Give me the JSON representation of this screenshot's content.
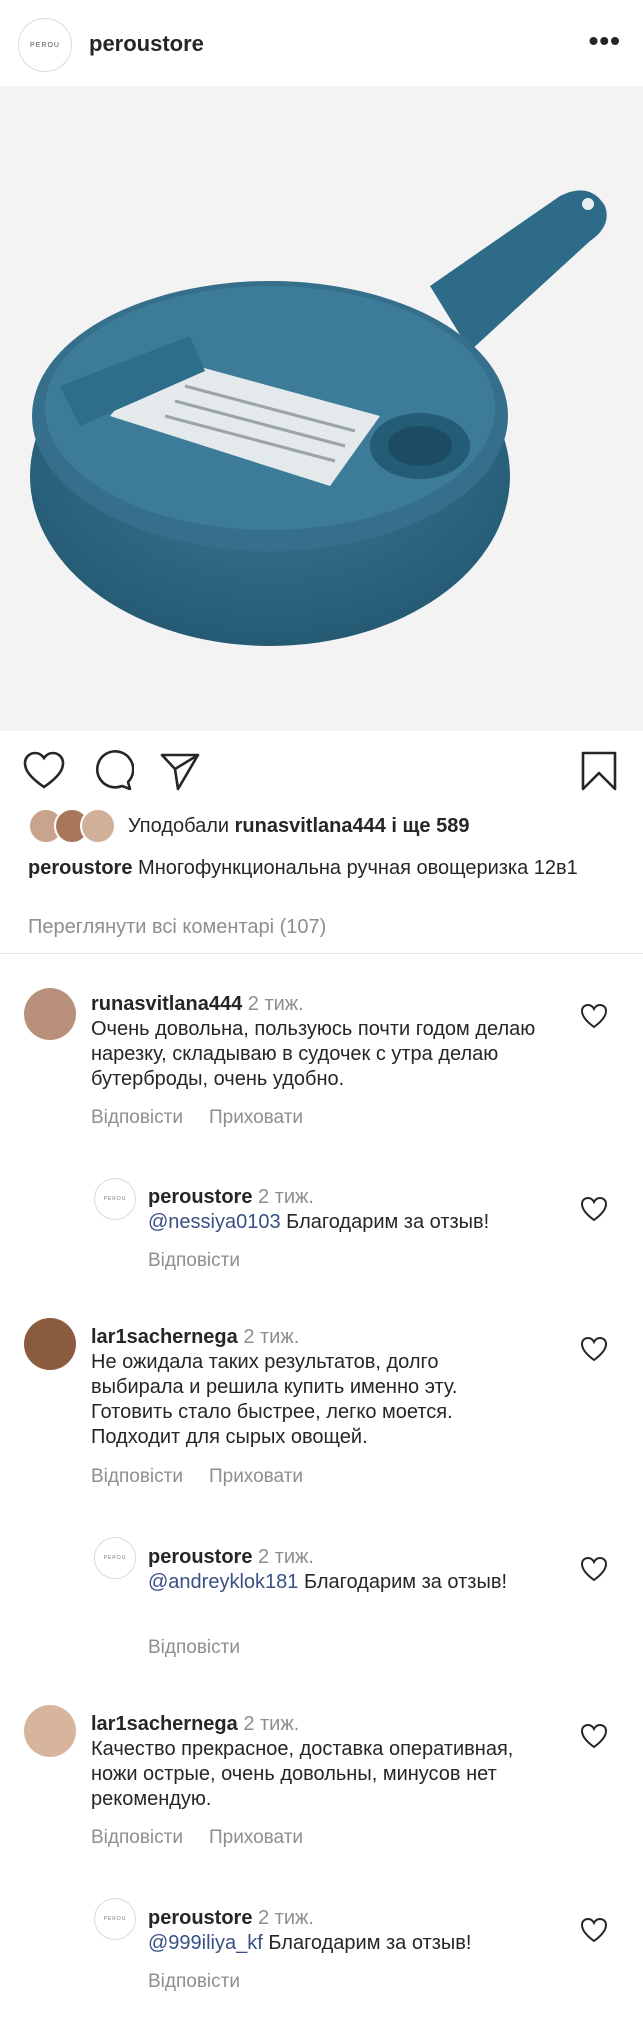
{
  "header": {
    "username": "peroustore",
    "logo_text": "PEROU",
    "more_label": "•••"
  },
  "post": {
    "likes_prefix": "Уподобали",
    "likes_user": "runasvitlana444",
    "likes_suffix": "і ще 589",
    "caption_user": "peroustore",
    "caption_text": "Многофункциональна ручная овощеризка 12в1",
    "view_all": "Переглянути всі коментарі (107)"
  },
  "comments": [
    {
      "user": "runasvitlana444",
      "time": "2 тиж.",
      "text": "Очень довольна, пользуюсь почти годом делаю нарезку, складываю в судочек с утра делаю бутерброды, очень удобно.",
      "reply": "Відповісти",
      "hide": "Приховати"
    },
    {
      "user": "peroustore",
      "time": "2 тиж.",
      "mention": "@nessiya0103",
      "text": "Благодарим за отзыв!",
      "reply": "Відповісти"
    },
    {
      "user": "lar1sachernega",
      "time": "2 тиж.",
      "text": "Не ожидала таких результатов, долго выбирала и решила купить именно эту. Готовить стало быстрее, легко моется. Подходит для сырых овощей.",
      "reply": "Відповісти",
      "hide": "Приховати"
    },
    {
      "user": "peroustore",
      "time": "2 тиж.",
      "mention": "@andreyklok181",
      "text": "Благодарим за отзыв!",
      "reply": "Відповісти"
    },
    {
      "user": "lar1sachernega",
      "time": "2 тиж.",
      "text": "Качество прекрасное, доставка оперативная, ножи острые, очень довольны, минусов нет рекомендую.",
      "reply": "Відповісти",
      "hide": "Приховати"
    },
    {
      "user": "peroustore",
      "time": "2 тиж.",
      "mention": "@999iliya_kf",
      "text": "Благодарим за отзыв!",
      "reply": "Відповісти"
    }
  ],
  "colors": {
    "product_blue": "#2f6a86",
    "link": "#385185",
    "muted": "#8e8e8e"
  },
  "icons": [
    "heart-icon",
    "comment-icon",
    "share-icon",
    "bookmark-icon",
    "more-icon"
  ]
}
